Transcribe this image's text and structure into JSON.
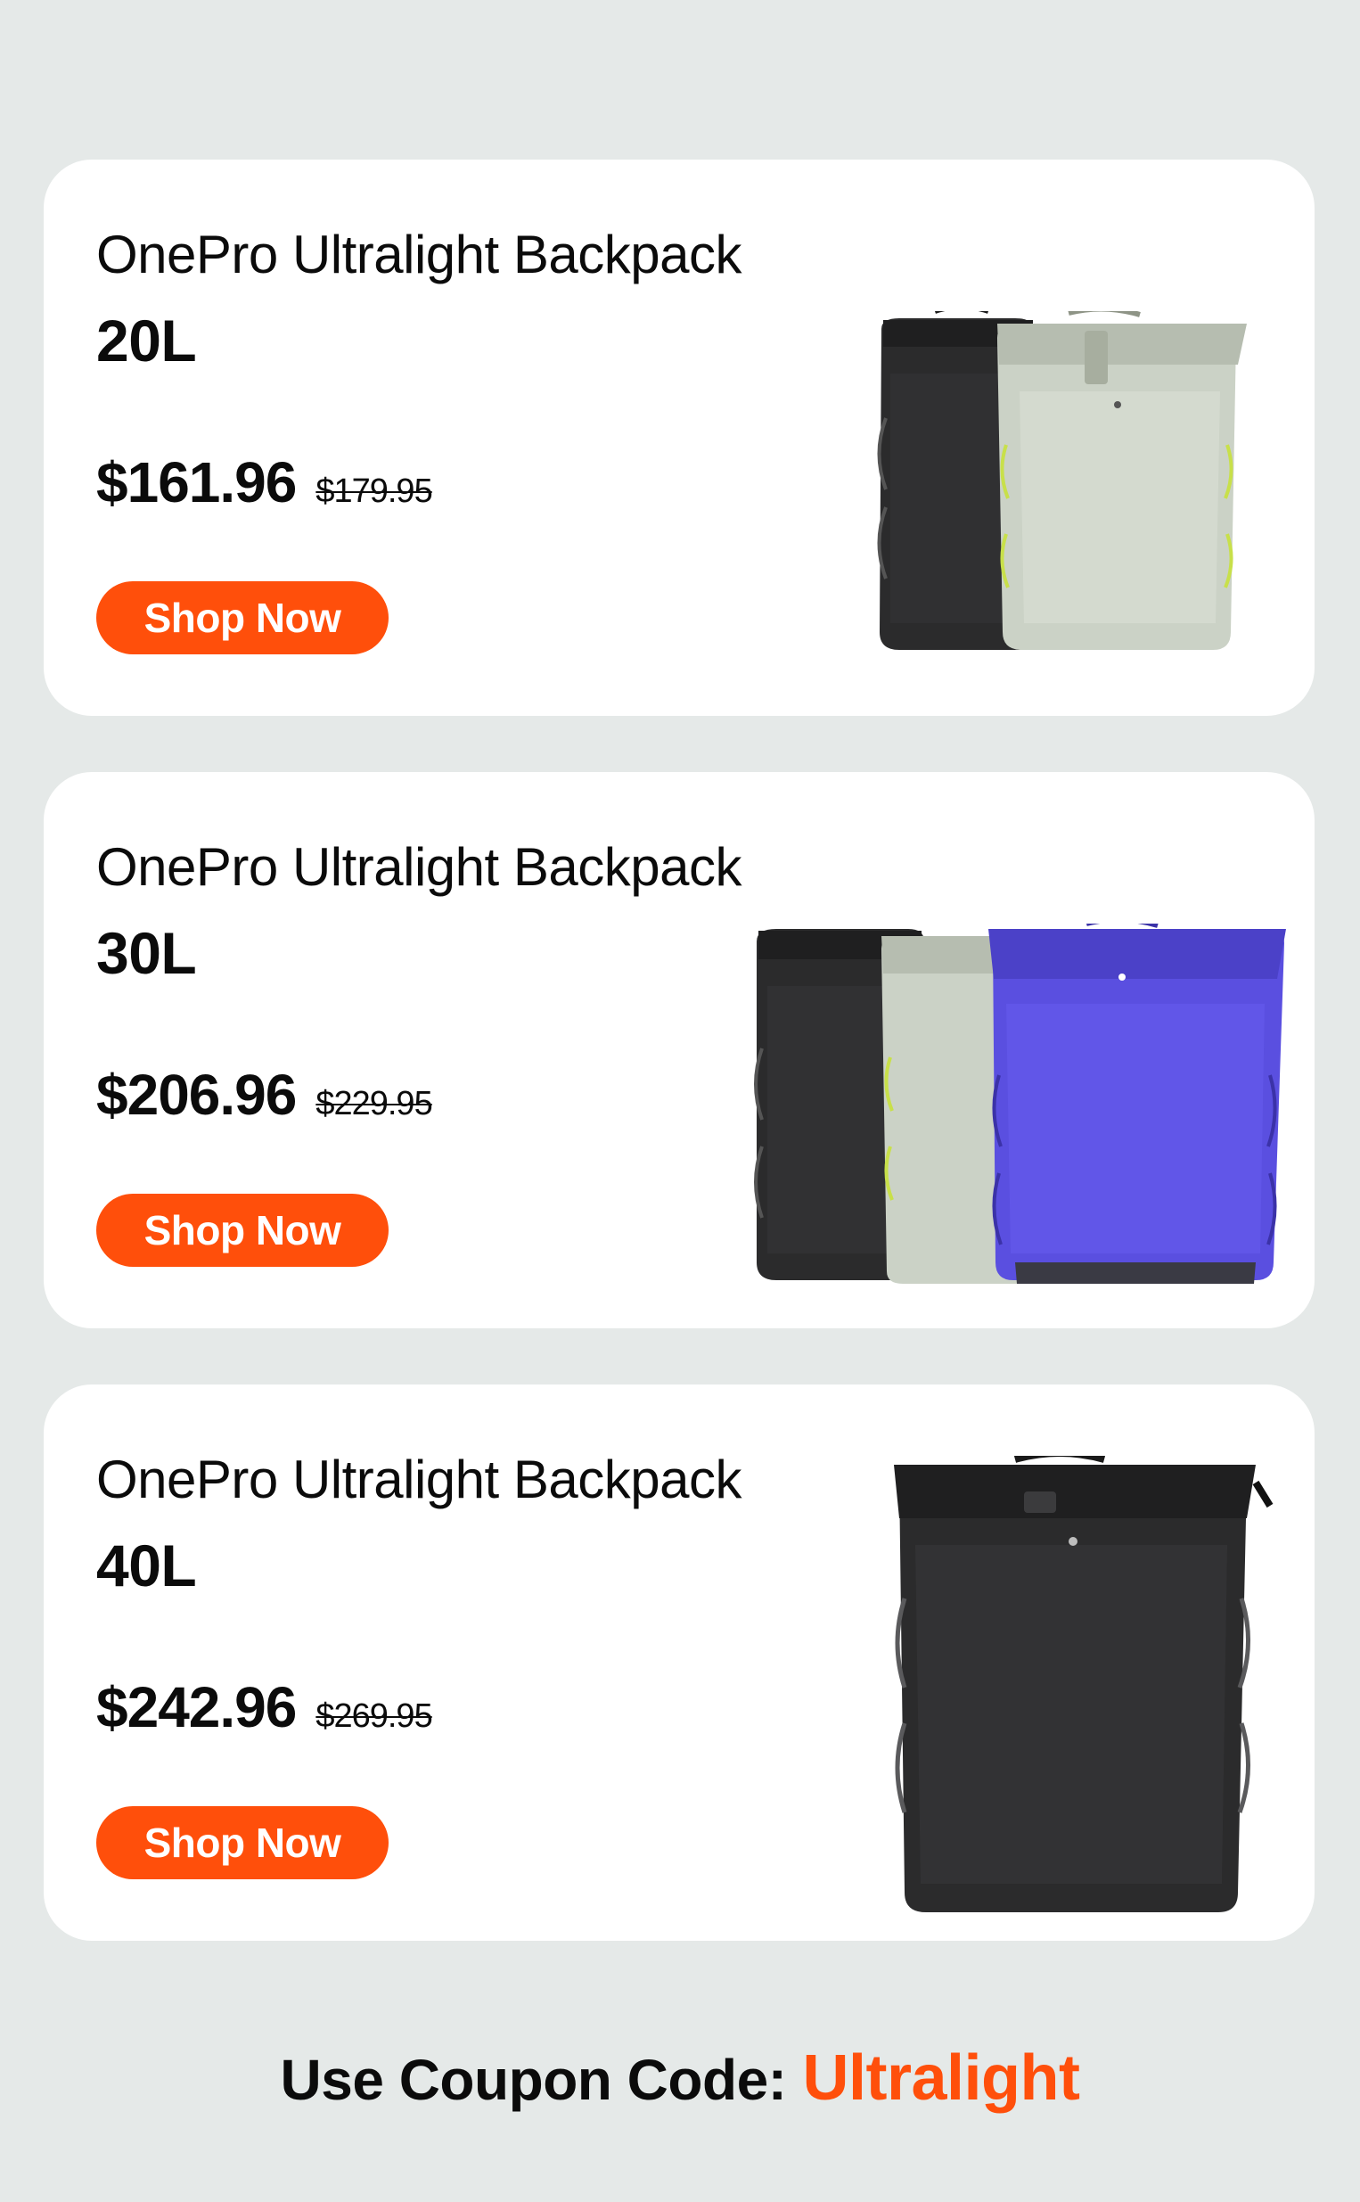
{
  "products": [
    {
      "title": "OnePro Ultralight Backpack",
      "capacity": "20L",
      "price": "$161.96",
      "old_price": "$179.95",
      "button": "Shop Now",
      "colors": [
        "#2b2b2c",
        "#cbd2c6"
      ]
    },
    {
      "title": "OnePro Ultralight Backpack",
      "capacity": "30L",
      "price": "$206.96",
      "old_price": "$229.95",
      "button": "Shop Now",
      "colors": [
        "#2b2b2c",
        "#cbd2c6",
        "#5a4fe0"
      ]
    },
    {
      "title": "OnePro Ultralight Backpack",
      "capacity": "40L",
      "price": "$242.96",
      "old_price": "$269.95",
      "button": "Shop Now",
      "colors": [
        "#2b2b2c"
      ]
    }
  ],
  "coupon": {
    "label": "Use Coupon Code:",
    "code": "Ultralight"
  },
  "theme": {
    "accent": "#ff4f0b",
    "background": "#e5e9e8",
    "card": "#ffffff"
  }
}
